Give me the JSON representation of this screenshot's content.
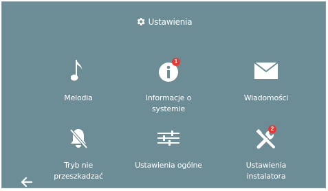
{
  "header": {
    "title": "Ustawienia",
    "icon": "gear-icon"
  },
  "tiles": [
    {
      "label": "Melodia",
      "icon": "music-note-icon"
    },
    {
      "label": "Informacje o\nsystemie",
      "icon": "info-icon",
      "badge": "1"
    },
    {
      "label": "Wiadomości",
      "icon": "envelope-icon"
    },
    {
      "label": "Tryb nie\nprzeszkadzać",
      "icon": "bell-off-icon"
    },
    {
      "label": "Ustawienia ogólne",
      "icon": "sliders-icon"
    },
    {
      "label": "Ustawienia\ninstalatora",
      "icon": "tools-icon",
      "badge": "2"
    }
  ],
  "nav": {
    "back_icon": "back-arrow-icon"
  },
  "colors": {
    "background": "#6c8d96",
    "foreground": "#ffffff",
    "badge": "#e53935"
  }
}
